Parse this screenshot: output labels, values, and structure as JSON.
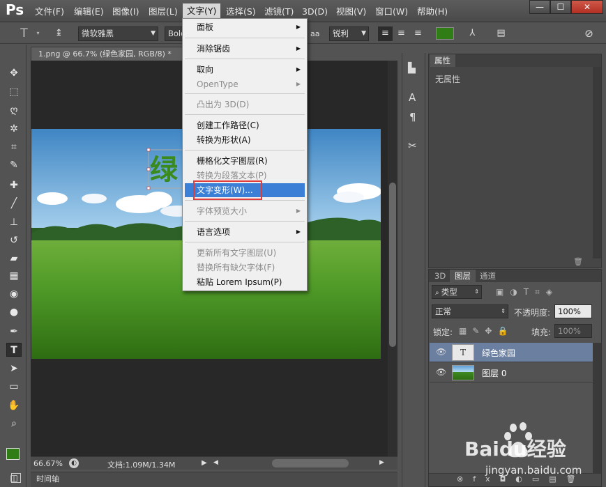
{
  "menubar": {
    "items": [
      "文件(F)",
      "编辑(E)",
      "图像(I)",
      "图层(L)",
      "文字(Y)",
      "选择(S)",
      "滤镜(T)",
      "3D(D)",
      "视图(V)",
      "窗口(W)",
      "帮助(H)"
    ],
    "logo": "Ps",
    "window_controls": [
      "—",
      "☐",
      "✕"
    ]
  },
  "options_bar": {
    "font_family": "微软雅黑",
    "font_style": "Bold",
    "aa_label": "aa",
    "antialias": "锐利",
    "text_color": "#2f7d14"
  },
  "document": {
    "tab_title": "1.png @ 66.7% (绿色家园, RGB/8) *",
    "tab_close": "×",
    "canvas_text": "绿",
    "zoom": "66.67%",
    "doc_size": "文档:1.09M/1.34M"
  },
  "timeline": {
    "label": "时间轴"
  },
  "text_menu": {
    "items": [
      {
        "label": "面板",
        "submenu": true,
        "disabled": false
      },
      {
        "label": "消除锯齿",
        "submenu": true,
        "disabled": false
      },
      {
        "label": "取向",
        "submenu": true,
        "disabled": false
      },
      {
        "label": "OpenType",
        "submenu": true,
        "disabled": true
      },
      {
        "label": "凸出为 3D(D)",
        "submenu": false,
        "disabled": true
      },
      {
        "label": "创建工作路径(C)",
        "submenu": false,
        "disabled": false
      },
      {
        "label": "转换为形状(A)",
        "submenu": false,
        "disabled": false
      },
      {
        "label": "栅格化文字图层(R)",
        "submenu": false,
        "disabled": false
      },
      {
        "label": "转换为段落文本(P)",
        "submenu": false,
        "disabled": true
      },
      {
        "label": "文字变形(W)...",
        "submenu": false,
        "disabled": false,
        "highlighted": true
      },
      {
        "label": "字体预览大小",
        "submenu": true,
        "disabled": true
      },
      {
        "label": "语言选项",
        "submenu": true,
        "disabled": false
      },
      {
        "label": "更新所有文字图层(U)",
        "submenu": false,
        "disabled": true
      },
      {
        "label": "替换所有缺欠字体(F)",
        "submenu": false,
        "disabled": true
      },
      {
        "label": "粘贴 Lorem Ipsum(P)",
        "submenu": false,
        "disabled": false
      }
    ]
  },
  "properties_panel": {
    "tab": "属性",
    "empty_text": "无属性"
  },
  "layers_panel": {
    "tabs": [
      "3D",
      "图层",
      "通道"
    ],
    "filter": "类型",
    "blend_mode": "正常",
    "opacity_label": "不透明度:",
    "opacity_value": "100%",
    "lock_label": "锁定:",
    "fill_label": "填充:",
    "fill_value": "100%",
    "layers": [
      {
        "name": "绿色家园",
        "type": "text",
        "selected": true
      },
      {
        "name": "图层 0",
        "type": "image",
        "selected": false
      }
    ]
  },
  "watermark": {
    "brand": "Baidu经验",
    "url": "jingyan.baidu.com"
  }
}
